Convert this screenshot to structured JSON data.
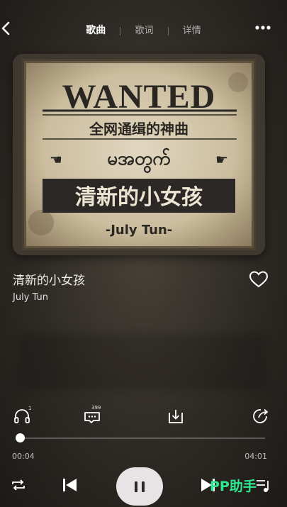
{
  "header": {
    "tabs": [
      {
        "label": "歌曲"
      },
      {
        "label": "歌词"
      },
      {
        "label": "详情"
      }
    ]
  },
  "cover": {
    "headline": "WANTED",
    "subtitle": "全网通缉的神曲",
    "burmese": "မအတွက်",
    "title": "清新的小女孩",
    "artist": "-July Tun-"
  },
  "song": {
    "title": "清新的小女孩",
    "artist": "July Tun"
  },
  "actions": {
    "listen_badge": "1",
    "comment_count": "399"
  },
  "progress": {
    "current": "00:04",
    "total": "04:01",
    "fraction": 0.017
  },
  "watermark": "PP助手",
  "colors": {
    "accent": "#2ee88f",
    "background": "#2e2a25",
    "play_button": "#e8e4e5"
  }
}
